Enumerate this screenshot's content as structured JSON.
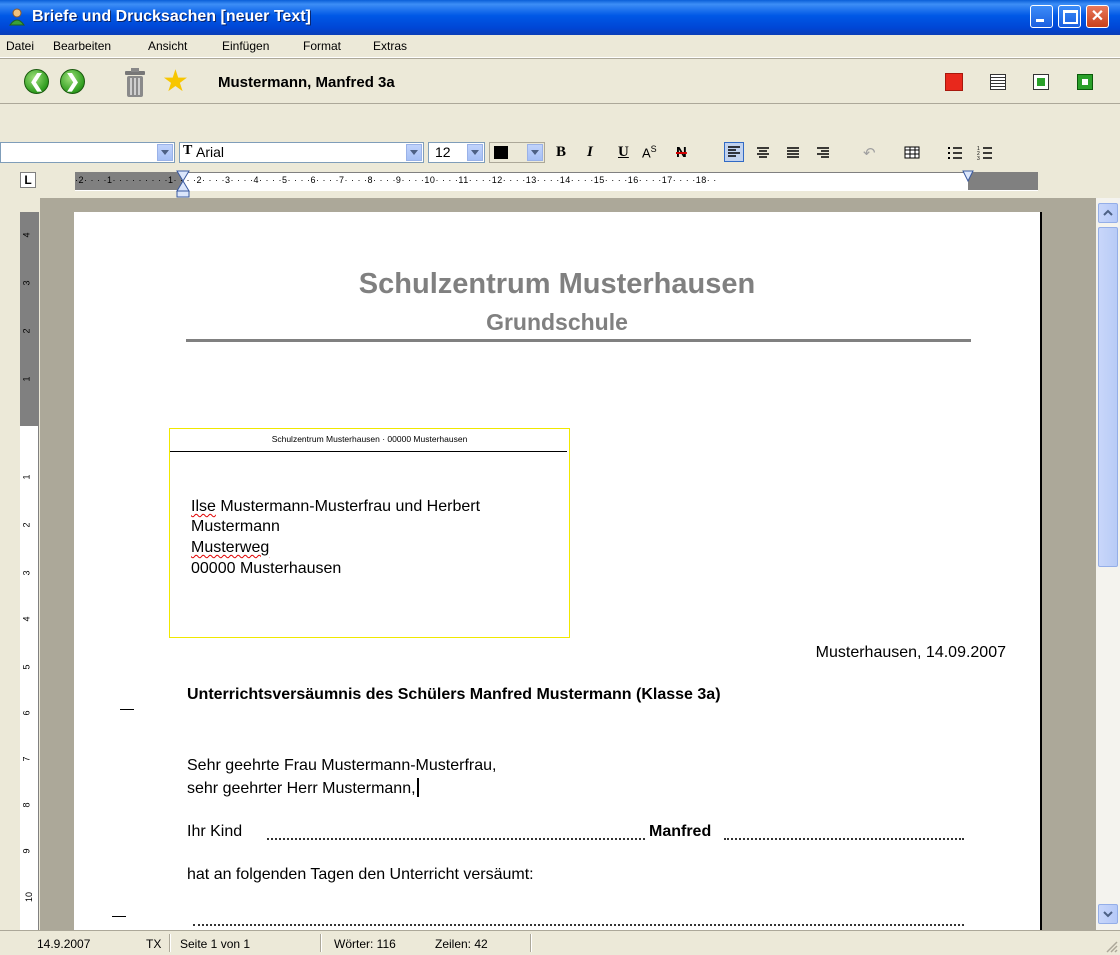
{
  "window": {
    "title": "Briefe und Drucksachen [neuer Text]"
  },
  "menu": [
    "Datei",
    "Bearbeiten",
    "Ansicht",
    "Einfügen",
    "Format",
    "Extras"
  ],
  "toolbar": {
    "student": "Mustermann, Manfred   3a"
  },
  "format_bar": {
    "style_value": "",
    "font_value": "Arial",
    "size_value": "12",
    "bold_label": "B",
    "italic_label": "I",
    "underline_label": "U",
    "superscript_label": "A",
    "superscript_mark": "S",
    "strike_label": "N"
  },
  "ruler": {
    "tab_selector": "L",
    "numbers": "·2· · · ·1· · · · · · · · ·1· · · ·2· · · ·3· · · ·4· · · ·5· · · ·6· · · ·7· · · ·8· · · ·9· · · ·10· · · ·11· · · ·12· · · ·13· · · ·14· · · ·15· · · ·16· · · ·17· · · ·18· ·"
  },
  "vruler": [
    "4",
    "3",
    "2",
    "1",
    "1",
    "2",
    "3",
    "4",
    "5",
    "6",
    "7",
    "8",
    "9",
    "10"
  ],
  "document": {
    "school": "Schulzentrum Musterhausen",
    "school_sub": "Grundschule",
    "sender_line": "Schulzentrum Musterhausen · 00000 Musterhausen",
    "address": {
      "line1_a": "Ilse",
      "line1_b": " Mustermann-Musterfrau und Herbert",
      "line2": "Mustermann",
      "line3": "Musterweg",
      "line4": "00000 Musterhausen"
    },
    "date": "Musterhausen, 14.09.2007",
    "subject": "Unterrichtsversäumnis des Schülers Manfred Mustermann (Klasse 3a)",
    "salutation1": "Sehr geehrte Frau Mustermann-Musterfrau,",
    "salutation2": "sehr geehrter Herr Mustermann,",
    "child_label": "Ihr Kind",
    "child_name": "Manfred",
    "missed_text": "hat an folgenden Tagen den Unterricht versäumt:"
  },
  "status": {
    "date": "14.9.2007",
    "mode": "TX",
    "page": "Seite 1 von 1",
    "words": "Wörter: 116",
    "lines": "Zeilen: 42"
  },
  "colors": {
    "title_bar": "#0058e6",
    "stop_button": "#e8281c",
    "nav_green": "#2e9c1e",
    "heading_gray": "#808080"
  }
}
